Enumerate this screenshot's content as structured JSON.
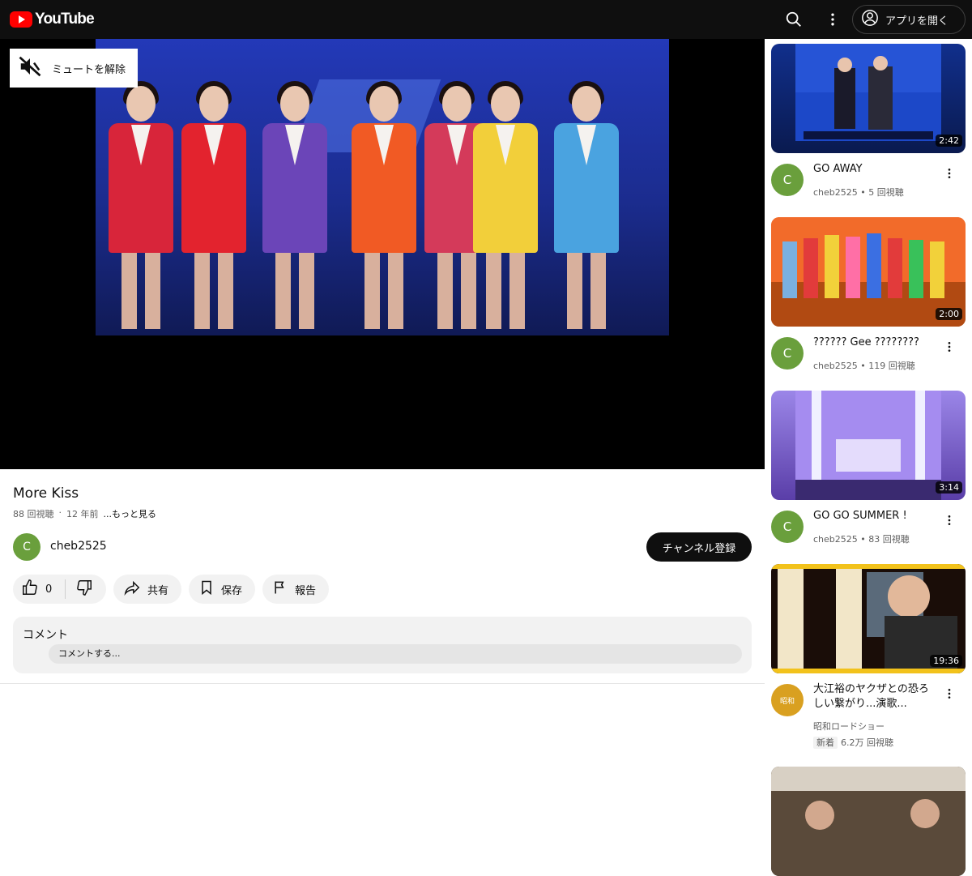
{
  "header": {
    "logo_text": "YouTube",
    "open_app_label": "アプリを開く",
    "icons": [
      "search-icon",
      "more-vert-icon",
      "account-icon"
    ]
  },
  "player": {
    "mute_label": "ミュートを解除"
  },
  "video": {
    "title": "More Kiss",
    "views": "88 回視聴",
    "age": "12 年前",
    "more_label": "...もっと見る"
  },
  "channel": {
    "initial": "C",
    "name": "cheb2525",
    "subscribe_label": "チャンネル登録",
    "avatar_color": "#6a9f3c"
  },
  "actions": {
    "like_count": "0",
    "share_label": "共有",
    "save_label": "保存",
    "report_label": "報告"
  },
  "comments": {
    "title": "コメント",
    "placeholder": "コメントする..."
  },
  "recommendations": [
    {
      "title": "GO AWAY",
      "channel": "cheb2525",
      "views": "5 回視聴",
      "duration": "2:42",
      "initial": "C"
    },
    {
      "title": "?????? Gee ????????",
      "channel": "cheb2525",
      "views": "119 回視聴",
      "duration": "2:00",
      "initial": "C"
    },
    {
      "title": "GO GO SUMMER !",
      "channel": "cheb2525",
      "views": "83 回視聴",
      "duration": "3:14",
      "initial": "C"
    },
    {
      "title": "大江裕のヤクザとの恐ろしい繋がり...演歌...",
      "channel": "昭和ロードショー",
      "badge": "新着",
      "views": "6.2万 回視聴",
      "duration": "19:36",
      "initial": "昭和"
    }
  ]
}
